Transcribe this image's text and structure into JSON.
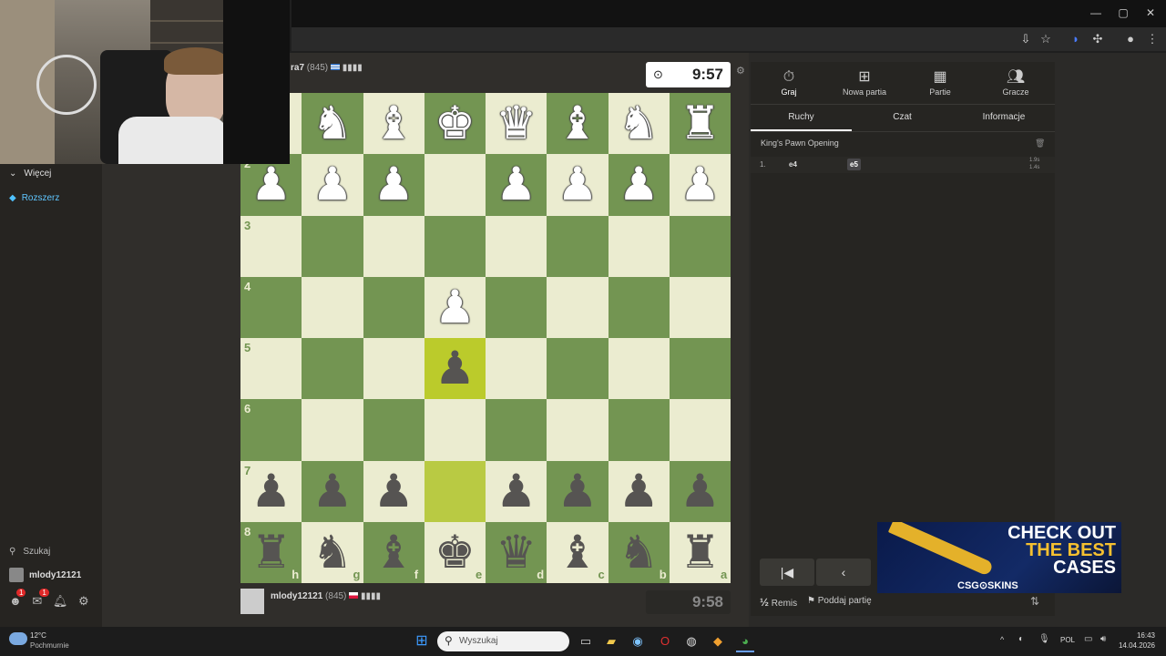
{
  "browser": {
    "win_minimize": "—",
    "win_maximize": "▢",
    "win_close": "✕"
  },
  "sidebar": {
    "more_label": "Więcej",
    "upgrade_label": "Rozszerz",
    "search_label": "Szukaj",
    "username": "mlody12121",
    "notif_badge_friends": "1",
    "notif_badge_mail": "1"
  },
  "opponent": {
    "name_partial": "ra7",
    "rating": "(845)"
  },
  "player": {
    "name": "mlody12121",
    "rating": "(845)"
  },
  "clocks": {
    "top": "9:57",
    "bottom": "9:58"
  },
  "board": {
    "rank_labels": [
      "2",
      "3",
      "4",
      "5",
      "6",
      "7",
      "8"
    ],
    "file_labels": [
      "h",
      "g",
      "f",
      "e",
      "d",
      "c",
      "b",
      "a"
    ]
  },
  "panel": {
    "tabs": [
      {
        "label": "Graj",
        "icon": "stopwatch-icon"
      },
      {
        "label": "Nowa partia",
        "icon": "plus-icon"
      },
      {
        "label": "Partie",
        "icon": "board-icon"
      },
      {
        "label": "Gracze",
        "icon": "players-icon"
      }
    ],
    "subtabs": [
      "Ruchy",
      "Czat",
      "Informacje"
    ],
    "opening": "King's Pawn Opening",
    "moves": [
      {
        "num": "1.",
        "white": "e4",
        "black": "e5",
        "time_white": "1.9s",
        "time_black": "1.4s"
      }
    ],
    "draw_label": "Remis",
    "resign_label": "Poddaj partię",
    "half_symbol": "½"
  },
  "ad": {
    "line1": "CHECK OUT",
    "line2": "THE BEST",
    "line3": "CASES",
    "brand": "CSG⊙SKINS"
  },
  "taskbar": {
    "weather_temp": "12°C",
    "weather_desc": "Pochmurnie",
    "search_placeholder": "Wyszukaj",
    "lang": "POL",
    "time": "16:43",
    "date": "14.04.2026"
  }
}
